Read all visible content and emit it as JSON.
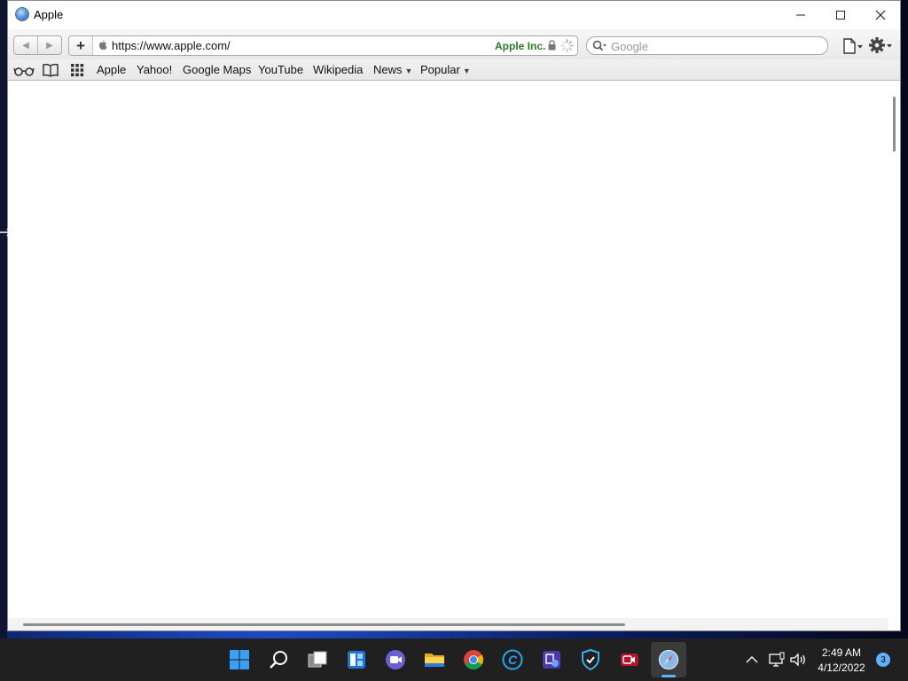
{
  "window": {
    "title": "Apple"
  },
  "toolbar": {
    "url": "https://www.apple.com/",
    "site_identity": "Apple Inc.",
    "search_placeholder": "Google"
  },
  "bookmarks": {
    "items": [
      {
        "label": "Apple"
      },
      {
        "label": "Yahoo!"
      },
      {
        "label": "Google Maps"
      },
      {
        "label": "YouTube"
      },
      {
        "label": "Wikipedia"
      },
      {
        "label": "News",
        "dropdown": true
      },
      {
        "label": "Popular",
        "dropdown": true
      }
    ]
  },
  "taskbar": {
    "apps": [
      "start-icon",
      "search-icon",
      "task-view-icon",
      "widgets-icon",
      "teams-chat-icon",
      "file-explorer-icon",
      "chrome-icon",
      "ccleaner-icon",
      "app-icon",
      "defender-icon",
      "camera-app-icon",
      "safari-icon"
    ],
    "clock_time": "2:49 AM",
    "clock_date": "4/12/2022",
    "notification_count": "3"
  },
  "colors": {
    "site_identity": "#2a7a2a",
    "taskbar": "#202020",
    "active_indicator": "#5fb2ff"
  }
}
